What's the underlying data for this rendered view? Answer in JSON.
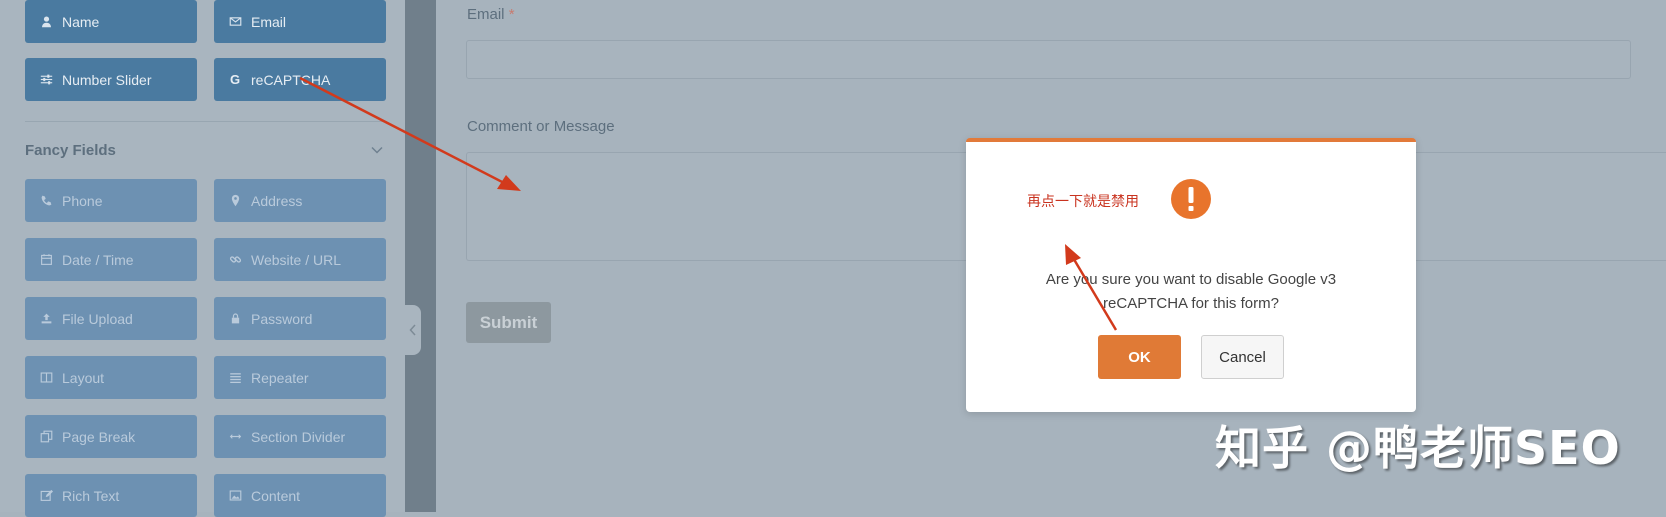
{
  "colors": {
    "std_field": "#4a7aa0",
    "fancy_field": "#6d91b2",
    "accent": "#e07a36",
    "annotation": "#c9331f"
  },
  "sidebar": {
    "standard_fields": [
      {
        "label": "Name",
        "icon": "user-icon"
      },
      {
        "label": "Email",
        "icon": "envelope-icon"
      },
      {
        "label": "Number Slider",
        "icon": "sliders-icon"
      },
      {
        "label": "reCAPTCHA",
        "icon": "google-icon"
      }
    ],
    "fancy_title": "Fancy Fields",
    "fancy_fields": [
      {
        "label": "Phone",
        "icon": "phone-icon"
      },
      {
        "label": "Address",
        "icon": "map-pin-icon"
      },
      {
        "label": "Date / Time",
        "icon": "calendar-icon"
      },
      {
        "label": "Website / URL",
        "icon": "link-icon"
      },
      {
        "label": "File Upload",
        "icon": "upload-icon"
      },
      {
        "label": "Password",
        "icon": "lock-icon"
      },
      {
        "label": "Layout",
        "icon": "columns-icon"
      },
      {
        "label": "Repeater",
        "icon": "list-icon"
      },
      {
        "label": "Page Break",
        "icon": "copy-icon"
      },
      {
        "label": "Section Divider",
        "icon": "arrows-h-icon"
      },
      {
        "label": "Rich Text",
        "icon": "edit-icon"
      },
      {
        "label": "Content",
        "icon": "image-icon"
      }
    ]
  },
  "form": {
    "email_label": "Email",
    "required_mark": "*",
    "message_label": "Comment or Message",
    "submit_label": "Submit"
  },
  "dialog": {
    "annotation": "再点一下就是禁用",
    "message": "Are you sure you want to disable Google v3 reCAPTCHA for this form?",
    "ok_label": "OK",
    "cancel_label": "Cancel"
  },
  "watermark": "知乎 @鸭老师SEO"
}
